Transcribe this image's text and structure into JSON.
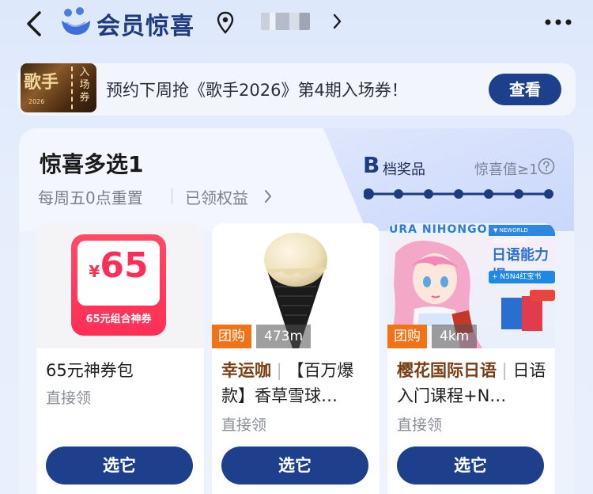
{
  "header": {
    "title": "会员惊喜",
    "location_blurred": ""
  },
  "banner": {
    "ticket_art": "歌手",
    "ticket_year": "2026",
    "ticket_stub": "入场券",
    "text": "预约下周抢《歌手2026》第4期入场券！",
    "button": "查看"
  },
  "card": {
    "title": "惊喜多选1",
    "reset_text": "每周五0点重置",
    "claimed_text": "已领权益",
    "tier_letter": "B",
    "tier_label": "档奖品",
    "surprise_value": "惊喜值≥1",
    "progress_steps": 7,
    "progress_current": 1
  },
  "products": [
    {
      "coupon_amount": "65",
      "coupon_currency": "¥",
      "coupon_label": "65元组合神券",
      "name": "65元神券包",
      "sub": "直接领",
      "button": "选它"
    },
    {
      "tag": "团购",
      "distance": "473m",
      "brand": "幸运咖",
      "name": "【百万爆款】香草雪球…",
      "sub": "直接领",
      "button": "选它"
    },
    {
      "top_text": "URA NIHONGO",
      "edu_text": "▼ NEWORLD EDUCATION",
      "ad_title": "日语能力提",
      "ad_pill": "+ N5N4红宝书",
      "tag": "团购",
      "distance": "4km",
      "brand": "樱花国际日语",
      "name": "日语入门课程+N…",
      "sub": "直接领",
      "button": "选它"
    }
  ],
  "colors": {
    "primary": "#1e3f8b",
    "title_blue": "#1f3b80",
    "group_tag": "#f07318",
    "coupon_red": "#ff2e55"
  }
}
